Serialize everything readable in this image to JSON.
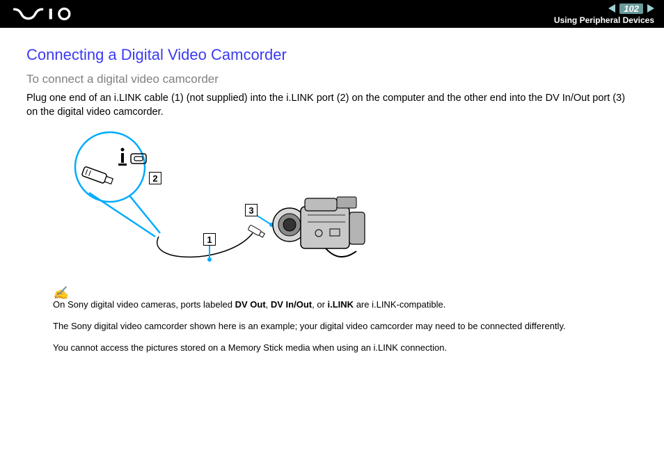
{
  "header": {
    "logo_alt": "VAIO",
    "page_number": "102",
    "section": "Using Peripheral Devices"
  },
  "title": "Connecting a Digital Video Camcorder",
  "subtitle": "To connect a digital video camcorder",
  "intro": "Plug one end of an i.LINK cable (1) (not supplied) into the i.LINK port (2) on the computer and the other end into the DV In/Out port (3) on the digital video camcorder.",
  "callouts": {
    "c1": "1",
    "c2": "2",
    "c3": "3"
  },
  "notes": {
    "n1_pre": "On Sony digital video cameras, ports labeled ",
    "n1_b1": "DV Out",
    "n1_m1": ", ",
    "n1_b2": "DV In/Out",
    "n1_m2": ", or ",
    "n1_b3": "i.LINK",
    "n1_post": " are i.LINK-compatible.",
    "n2": "The Sony digital video camcorder shown here is an example; your digital video camcorder may need to be connected differently.",
    "n3": "You cannot access the pictures stored on a Memory Stick media when using an i.LINK connection."
  }
}
